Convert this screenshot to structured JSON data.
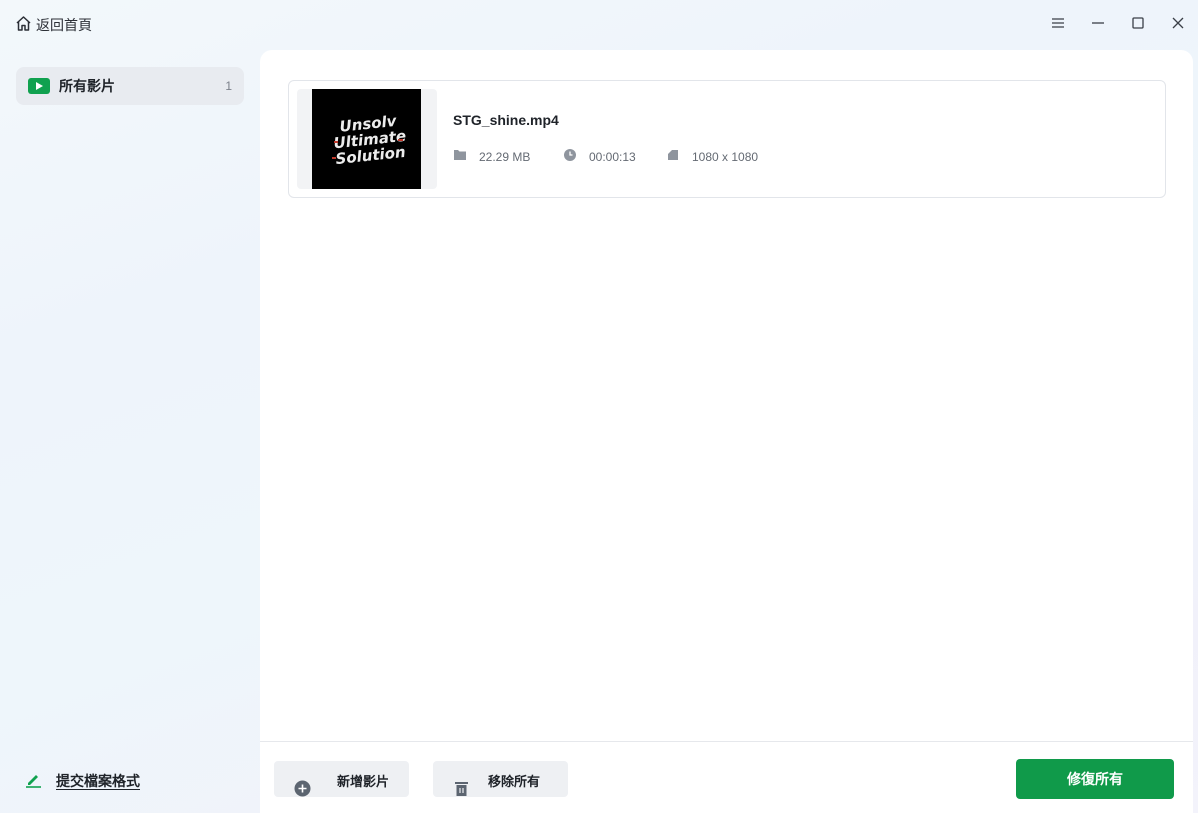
{
  "header": {
    "back_label": "返回首頁",
    "icons": [
      "home-icon",
      "menu-icon",
      "minimize-icon",
      "maximize-icon",
      "close-icon"
    ]
  },
  "sidebar": {
    "items": [
      {
        "label": "所有影片",
        "count": "1",
        "icon": "play-icon",
        "selected": true
      }
    ],
    "submit_format_label": "提交檔案格式"
  },
  "video_list": [
    {
      "name": "STG_shine.mp4",
      "size": "22.29 MB",
      "duration": "00:00:13",
      "resolution": "1080 x 1080",
      "thumbnail_text": "Unsolved Ultimate Solution"
    }
  ],
  "bottom_bar": {
    "add_label": "新增影片",
    "remove_all_label": "移除所有",
    "repair_all_label": "修復所有"
  },
  "colors": {
    "accent": "#109a4a",
    "sidebar_selected": "#e8ebf0",
    "card_border": "#e2e5ea"
  }
}
